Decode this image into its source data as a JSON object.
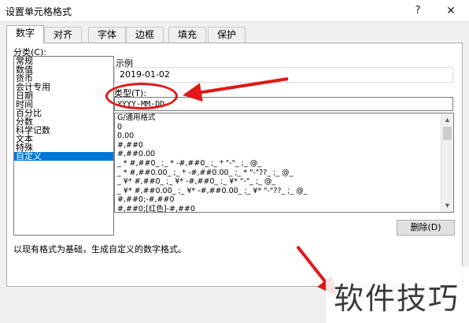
{
  "window": {
    "title": "设置单元格格式",
    "help": "?",
    "close": "✕"
  },
  "tabs": [
    "数字",
    "对齐",
    "字体",
    "边框",
    "填充",
    "保护"
  ],
  "active_tab": 0,
  "category": {
    "label": "分类(C):",
    "items": [
      "常规",
      "数值",
      "货币",
      "会计专用",
      "日期",
      "时间",
      "百分比",
      "分数",
      "科学记数",
      "文本",
      "特殊",
      "自定义"
    ],
    "selected_index": 11
  },
  "sample": {
    "label": "示例",
    "value": "2019-01-02"
  },
  "type": {
    "label": "类型(T):",
    "value": "YYYY-MM-DD"
  },
  "formats": [
    "G/通用格式",
    "0",
    "0.00",
    "#,##0",
    "#,##0.00",
    "_ * #,##0_ ;_ * -#,##0_ ;_ * \"-\"_ ;_ @_",
    "_ * #,##0.00_ ;_ * -#,##0.00_ ;_ * \"-\"??_ ;_ @_",
    "_ ¥* #,##0_ ;_ ¥* -#,##0_ ;_ ¥* \"-\"_ ;_ @_",
    "_ ¥* #,##0.00_ ;_ ¥* -#,##0.00_ ;_ ¥* \"-\"??_ ;_ @_",
    "#,##0;-#,##0",
    "#,##0;[红色]-#,##0"
  ],
  "delete_button": "删除(D)",
  "description": "以现有格式为基础，生成自定义的数字格式。",
  "watermark": "软件技巧",
  "scroll_icons": {
    "up": "▲",
    "down": "▼"
  }
}
